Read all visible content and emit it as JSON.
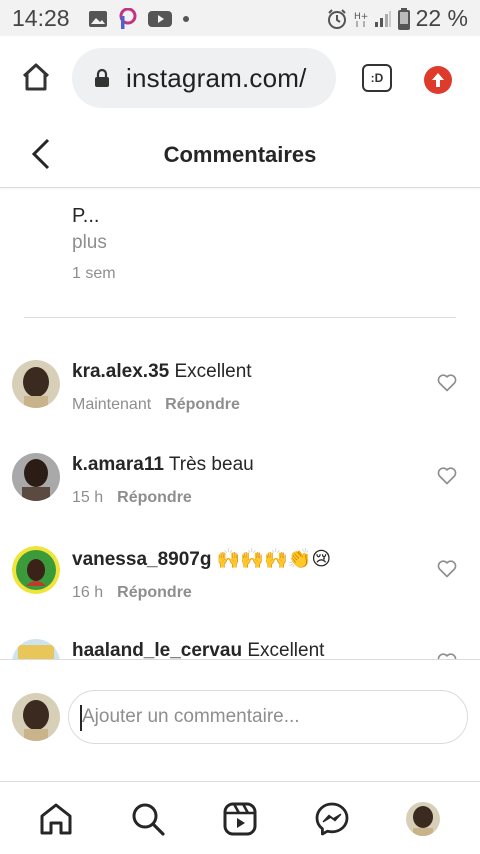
{
  "status_bar": {
    "time": "14:28",
    "battery": "22 %",
    "network": "H+"
  },
  "browser": {
    "url": "instagram.com/",
    "tabs_label": ":D"
  },
  "header": {
    "title": "Commentaires"
  },
  "caption": {
    "text": "P...",
    "more": "plus",
    "time": "1 sem"
  },
  "comments": [
    {
      "username": "kra.alex.35",
      "text": "Excellent",
      "time": "Maintenant",
      "reply": "Répondre"
    },
    {
      "username": "k.amara11",
      "text": "Très beau",
      "time": "15 h",
      "reply": "Répondre"
    },
    {
      "username": "vanessa_8907g",
      "text": "🙌🙌🙌👏😢",
      "time": "16 h",
      "reply": "Répondre"
    },
    {
      "username": "haaland_le_cervau",
      "text": "Excellent",
      "time": "",
      "reply": ""
    }
  ],
  "composer": {
    "placeholder": "Ajouter un commentaire..."
  },
  "colors": {
    "text": "#262626",
    "secondary": "#8e8e8e",
    "divider": "#dbdbdb",
    "upload_badge": "#dd3b2b"
  },
  "icons": {
    "back": "chevron-left-icon",
    "home": "home-icon",
    "search": "search-icon",
    "reels": "reels-icon",
    "messenger": "messenger-icon",
    "heart": "heart-outline-icon"
  }
}
